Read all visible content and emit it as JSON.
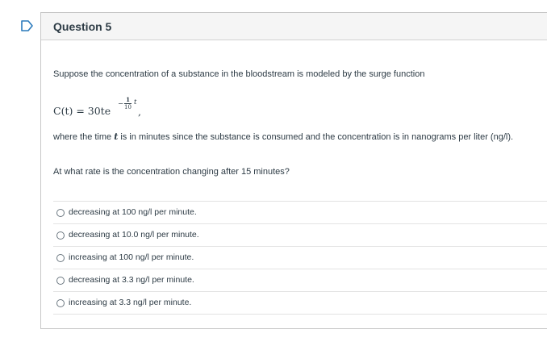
{
  "question": {
    "title": "Question 5",
    "prompt": "Suppose the concentration of a substance in the bloodstream is modeled by the surge function",
    "formula": {
      "lhs": "C(t) = 30te",
      "exp_sign": "−",
      "exp_num": "1",
      "exp_den": "10",
      "exp_var": "t",
      "trailing": ","
    },
    "where_pre": "where the time ",
    "where_var": "t",
    "where_post": " is in minutes since the substance is consumed and the concentration is in nanograms per liter (ng/l).",
    "ask": "At what rate is the concentration changing after 15 minutes?",
    "answers": [
      {
        "label": "decreasing at 100 ng/l per minute.",
        "selected": false
      },
      {
        "label": "decreasing at 10.0 ng/l per minute.",
        "selected": false
      },
      {
        "label": "increasing at 100 ng/l per minute.",
        "selected": false
      },
      {
        "label": "decreasing at 3.3 ng/l per minute.",
        "selected": false
      },
      {
        "label": "increasing at 3.3 ng/l per minute.",
        "selected": false
      }
    ]
  },
  "icons": {
    "flag": "flag-icon"
  },
  "colors": {
    "accent": "#2b7abc",
    "header_bg": "#f5f5f5",
    "border": "#c7c7c7"
  }
}
